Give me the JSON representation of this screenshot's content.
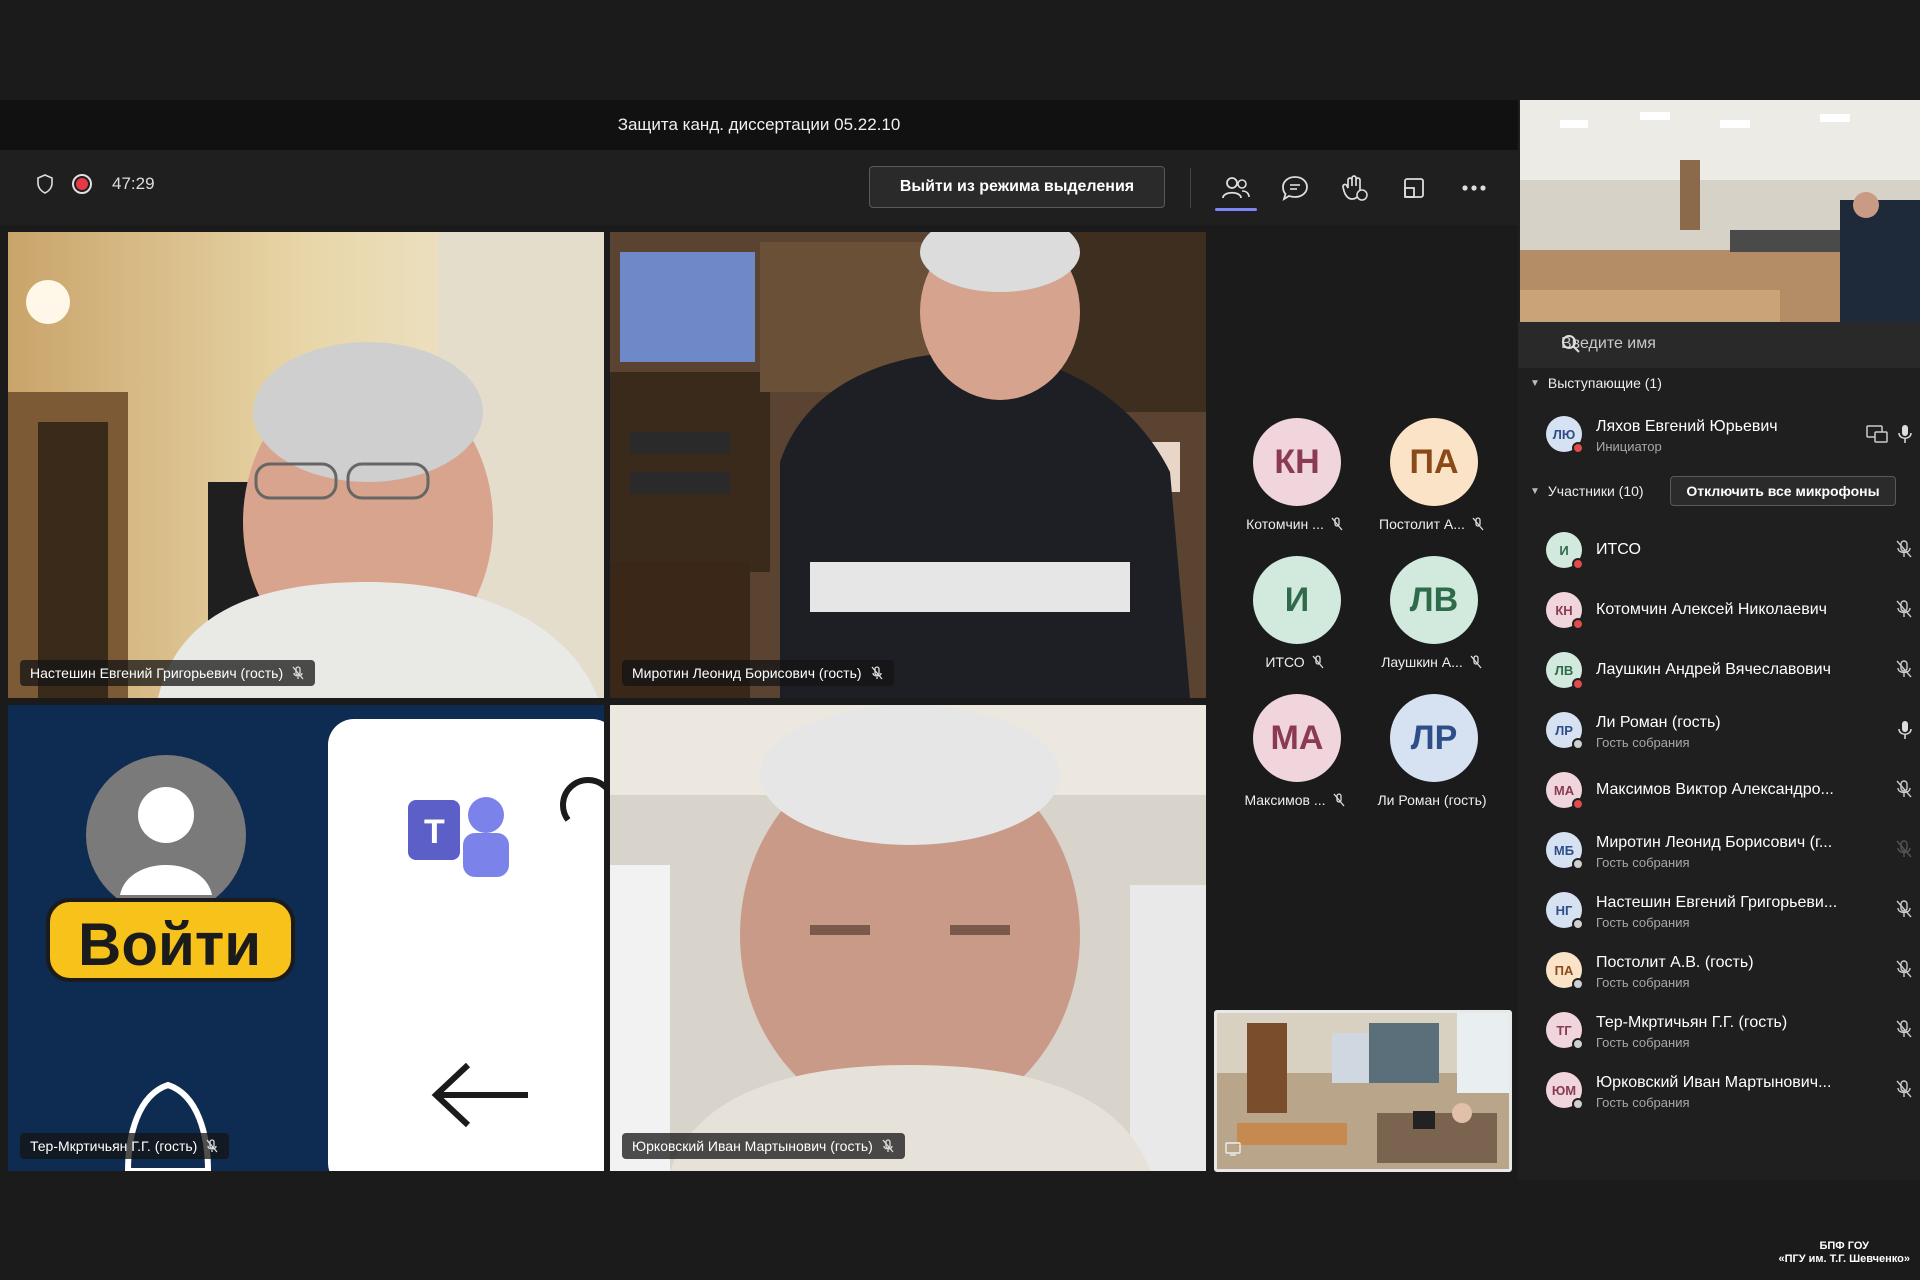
{
  "meeting": {
    "title": "Защита канд. диссертации 05.22.10",
    "timer": "47:29",
    "exit_spotlight_label": "Выйти из режима выделения"
  },
  "toolbar": {
    "icons": [
      "shield-icon",
      "record-icon",
      "people-icon",
      "chat-icon",
      "raise-hand-icon",
      "layout-icon",
      "more-icon"
    ]
  },
  "video_tiles": [
    {
      "name": "Настешин Евгений Григорьевич (гость)"
    },
    {
      "name": "Миротин Леонид Борисович (гость)"
    },
    {
      "name": "Тер-Мкртичьян Г.Г. (гость)",
      "screen_text": "Войти"
    },
    {
      "name": "Юрковский Иван Мартынович (гость)"
    }
  ],
  "avatar_grid": [
    {
      "initials": "КН",
      "label": "Котомчин ...",
      "bg": "#f0d6dc",
      "fg": "#8a3a52"
    },
    {
      "initials": "ПА",
      "label": "Постолит А...",
      "bg": "#fbe3c8",
      "fg": "#8a4a18"
    },
    {
      "initials": "И",
      "label": "ИТСО",
      "bg": "#d2eadd",
      "fg": "#2f6a4a"
    },
    {
      "initials": "ЛВ",
      "label": "Лаушкин А...",
      "bg": "#d2eadd",
      "fg": "#2f6a4a"
    },
    {
      "initials": "МА",
      "label": "Максимов ...",
      "bg": "#f0d6dc",
      "fg": "#8a3a52"
    },
    {
      "initials": "ЛР",
      "label": "Ли Роман (гость)",
      "bg": "#d6e1f2",
      "fg": "#2e4e88"
    }
  ],
  "panel": {
    "search_placeholder": "Введите имя",
    "presenters_header": "Выступающие (1)",
    "participants_header": "Участники (10)",
    "mute_all_label": "Отключить все микрофоны",
    "presenter": {
      "initials": "ЛЮ",
      "name": "Ляхов Евгений Юрьевич",
      "role": "Инициатор"
    },
    "participants": [
      {
        "initials": "И",
        "name": "ИТСО",
        "sub": "",
        "bg": "#d2eadd",
        "fg": "#2f6a4a",
        "status": "#e04b4b",
        "mic": "muted"
      },
      {
        "initials": "КН",
        "name": "Котомчин Алексей Николаевич",
        "sub": "",
        "bg": "#f0d6dc",
        "fg": "#8a3a52",
        "status": "#e04b4b",
        "mic": "muted"
      },
      {
        "initials": "ЛВ",
        "name": "Лаушкин Андрей Вячеславович",
        "sub": "",
        "bg": "#d2eadd",
        "fg": "#2f6a4a",
        "status": "#e04b4b",
        "mic": "muted"
      },
      {
        "initials": "ЛР",
        "name": "Ли Роман (гость)",
        "sub": "Гость собрания",
        "bg": "#d6e1f2",
        "fg": "#2e4e88",
        "status": "#cfcfcf",
        "mic": "on"
      },
      {
        "initials": "МА",
        "name": "Максимов Виктор Александро...",
        "sub": "",
        "bg": "#f0d6dc",
        "fg": "#8a3a52",
        "status": "#e04b4b",
        "mic": "muted"
      },
      {
        "initials": "МБ",
        "name": "Миротин Леонид Борисович (г...",
        "sub": "Гость собрания",
        "bg": "#d6e1f2",
        "fg": "#2e4e88",
        "status": "#cfcfcf",
        "mic": "dim"
      },
      {
        "initials": "НГ",
        "name": "Настешин Евгений Григорьеви...",
        "sub": "Гость собрания",
        "bg": "#d6e1f2",
        "fg": "#2e4e88",
        "status": "#cfcfcf",
        "mic": "muted"
      },
      {
        "initials": "ПА",
        "name": "Постолит А.В. (гость)",
        "sub": "Гость собрания",
        "bg": "#fbe3c8",
        "fg": "#8a4a18",
        "status": "#cfcfcf",
        "mic": "muted"
      },
      {
        "initials": "ТГ",
        "name": "Тер-Мкртичьян Г.Г. (гость)",
        "sub": "Гость собрания",
        "bg": "#f0d6dc",
        "fg": "#8a3a52",
        "status": "#cfcfcf",
        "mic": "muted"
      },
      {
        "initials": "ЮМ",
        "name": "Юрковский Иван Мартынович...",
        "sub": "Гость собрания",
        "bg": "#f0d6dc",
        "fg": "#8a3a52",
        "status": "#cfcfcf",
        "mic": "muted"
      }
    ]
  },
  "watermark": {
    "line1": "БПФ ГОУ",
    "line2": "«ПГУ им. Т.Г. Шевченко»"
  }
}
